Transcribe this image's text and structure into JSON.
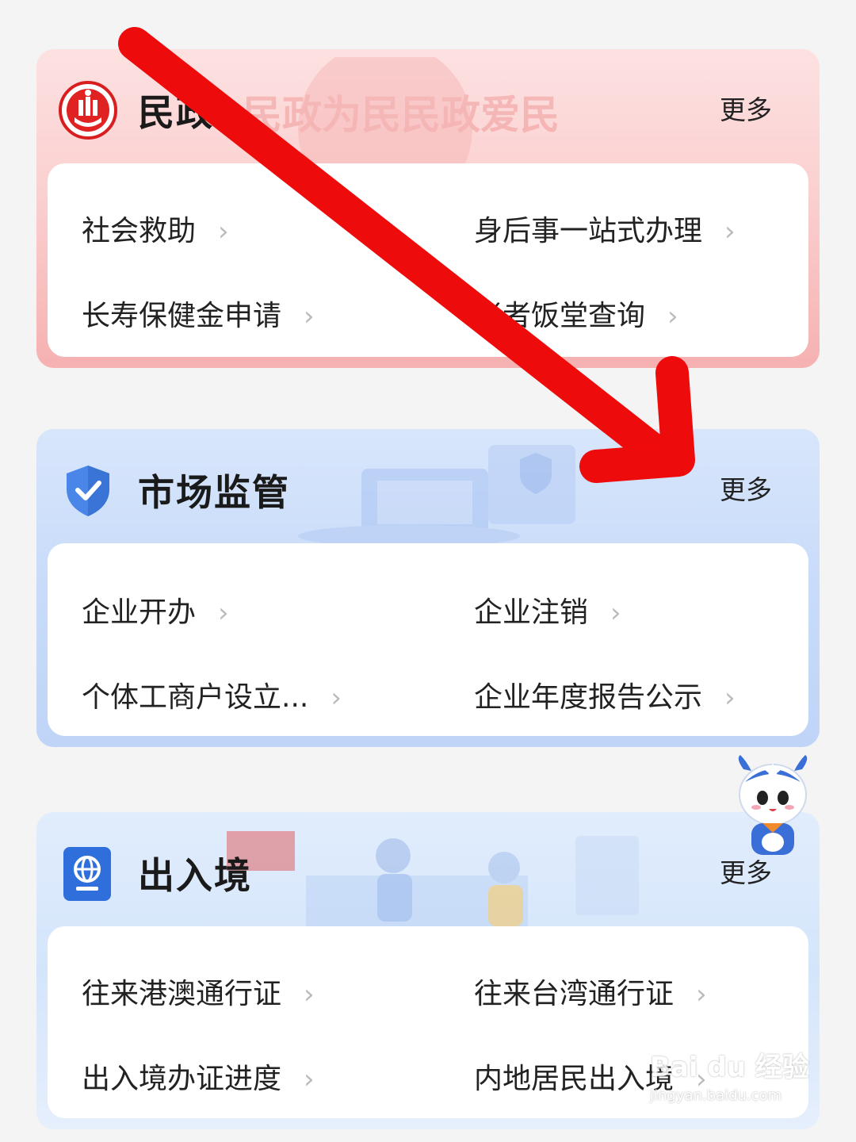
{
  "sections": [
    {
      "title": "民政",
      "more": "更多",
      "banner_text": "民政为民民政爱民",
      "items": [
        "社会救助",
        "身后事一站式办理",
        "长寿保健金申请",
        "老者饭堂查询"
      ]
    },
    {
      "title": "市场监管",
      "more": "更多",
      "items": [
        "企业开办",
        "企业注销",
        "个体工商户设立...",
        "企业年度报告公示"
      ]
    },
    {
      "title": "出入境",
      "more": "更多",
      "items": [
        "往来港澳通行证",
        "往来台湾通行证",
        "出入境办证进度",
        "内地居民出入境"
      ]
    }
  ],
  "watermark": {
    "main": "Bai du 经验",
    "sub": "jingyan.baidu.com"
  },
  "icons": {
    "chevron": "›",
    "civil_logo": "civil-affairs-logo-icon",
    "market_logo": "shield-check-icon",
    "exit_entry_logo": "globe-passport-icon",
    "mascot": "mascot-icon"
  },
  "colors": {
    "red_card": "#f6b1b1",
    "blue_card": "#c9dcfa",
    "light_blue_card": "#d4e5fb",
    "arrow": "#ee0b0b"
  }
}
